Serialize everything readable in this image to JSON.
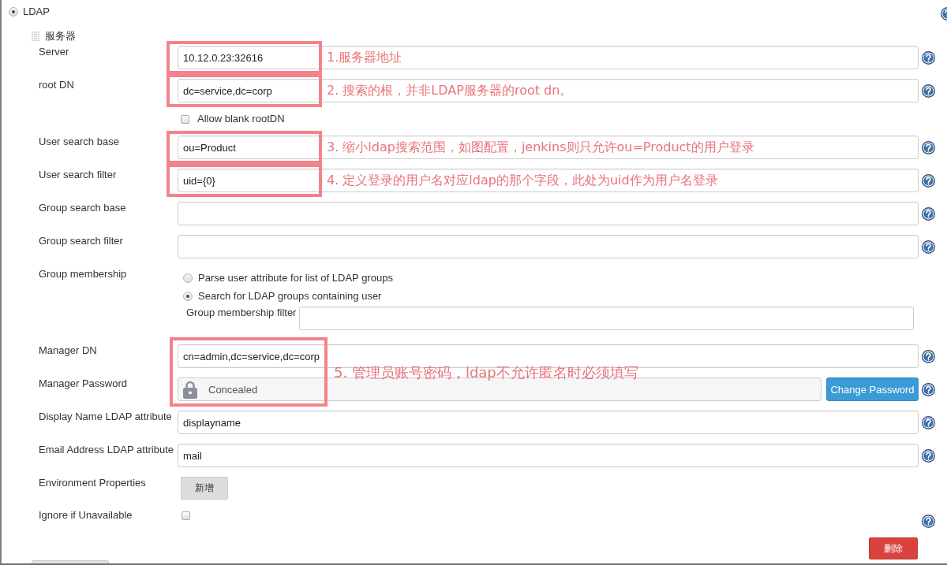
{
  "auth_option": {
    "label": "LDAP",
    "selected": true,
    "help": true
  },
  "section": {
    "title": "服务器"
  },
  "fields": [
    {
      "kind": "text",
      "label": "Server",
      "value": "10.12.0.23:32616",
      "help": true,
      "annotation": {
        "text": "1.服务器地址",
        "kind": "single"
      }
    },
    {
      "kind": "text",
      "label": "root DN",
      "value": "dc=service,dc=corp",
      "help": true,
      "annotation": {
        "text": "2. 搜索的根，并非LDAP服务器的root dn。",
        "kind": "single"
      },
      "option": {
        "label": "Allow blank rootDN",
        "checked": false
      }
    },
    {
      "kind": "text",
      "label": "User search base",
      "value": "ou=Product",
      "help": true,
      "annotation": {
        "text": "3. 缩小ldap搜索范围，如图配置，jenkins则只允许ou=Product的用户登录",
        "kind": "single"
      }
    },
    {
      "kind": "text",
      "label": "User search filter",
      "value": "uid={0}",
      "help": true,
      "annotation": {
        "text": "4. 定义登录的用户名对应ldap的那个字段，此处为uid作为用户名登录",
        "kind": "single"
      }
    },
    {
      "kind": "text",
      "label": "Group search base",
      "help": true
    },
    {
      "kind": "text",
      "label": "Group search filter",
      "help": true
    },
    {
      "kind": "radio-group",
      "label": "Group membership",
      "help": false,
      "options": [
        {
          "label": "Parse user attribute for list of LDAP groups",
          "selected": false
        },
        {
          "label": "Search for LDAP groups containing user",
          "selected": true
        }
      ],
      "sub_field": {
        "label": "Group membership filter"
      }
    },
    {
      "kind": "text",
      "label": "Manager DN",
      "value": "cn=admin,dc=service,dc=corp",
      "help": true,
      "annotation": {
        "text": "5. 管理员账号密码，ldap不允许匿名时必须填写",
        "kind": "double"
      }
    },
    {
      "kind": "password",
      "label": "Manager Password",
      "value": "Concealed",
      "button": "Change Password",
      "help": true
    },
    {
      "kind": "text",
      "label": "Display Name LDAP attribute",
      "value": "displayname",
      "help": true
    },
    {
      "kind": "text",
      "label": "Email Address LDAP attribute",
      "value": "mail",
      "help": true
    },
    {
      "kind": "add",
      "label": "Environment Properties",
      "button": "新增",
      "help": false
    },
    {
      "kind": "checkbox",
      "label": "Ignore if Unavailable",
      "checked": false,
      "help": true
    }
  ],
  "delete_button": "删除"
}
